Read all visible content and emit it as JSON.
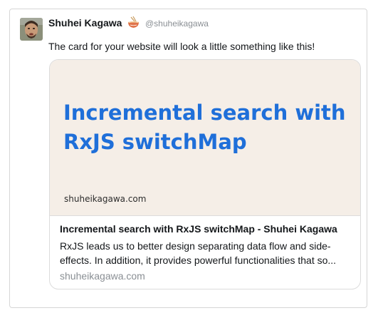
{
  "author": {
    "name": "Shuhei Kagawa",
    "handle": "@shuheikagawa",
    "emoji": "ramen-bowl-icon"
  },
  "tweet": {
    "text": "The card for your website will look a little something like this!"
  },
  "card_preview": {
    "image_title": "Incremental search with RxJS switchMap",
    "image_domain": "shuheikagawa.com",
    "title": "Incremental search with RxJS switchMap - Shuhei Kagawa",
    "description": "RxJS leads us to better design separating data flow and side-effects. In addition, it provides powerful functionalities that so...",
    "url": "shuheikagawa.com"
  },
  "colors": {
    "accent_blue": "#1f6fd9",
    "image_background": "#f5eee7",
    "muted_text": "#8a8f94"
  }
}
